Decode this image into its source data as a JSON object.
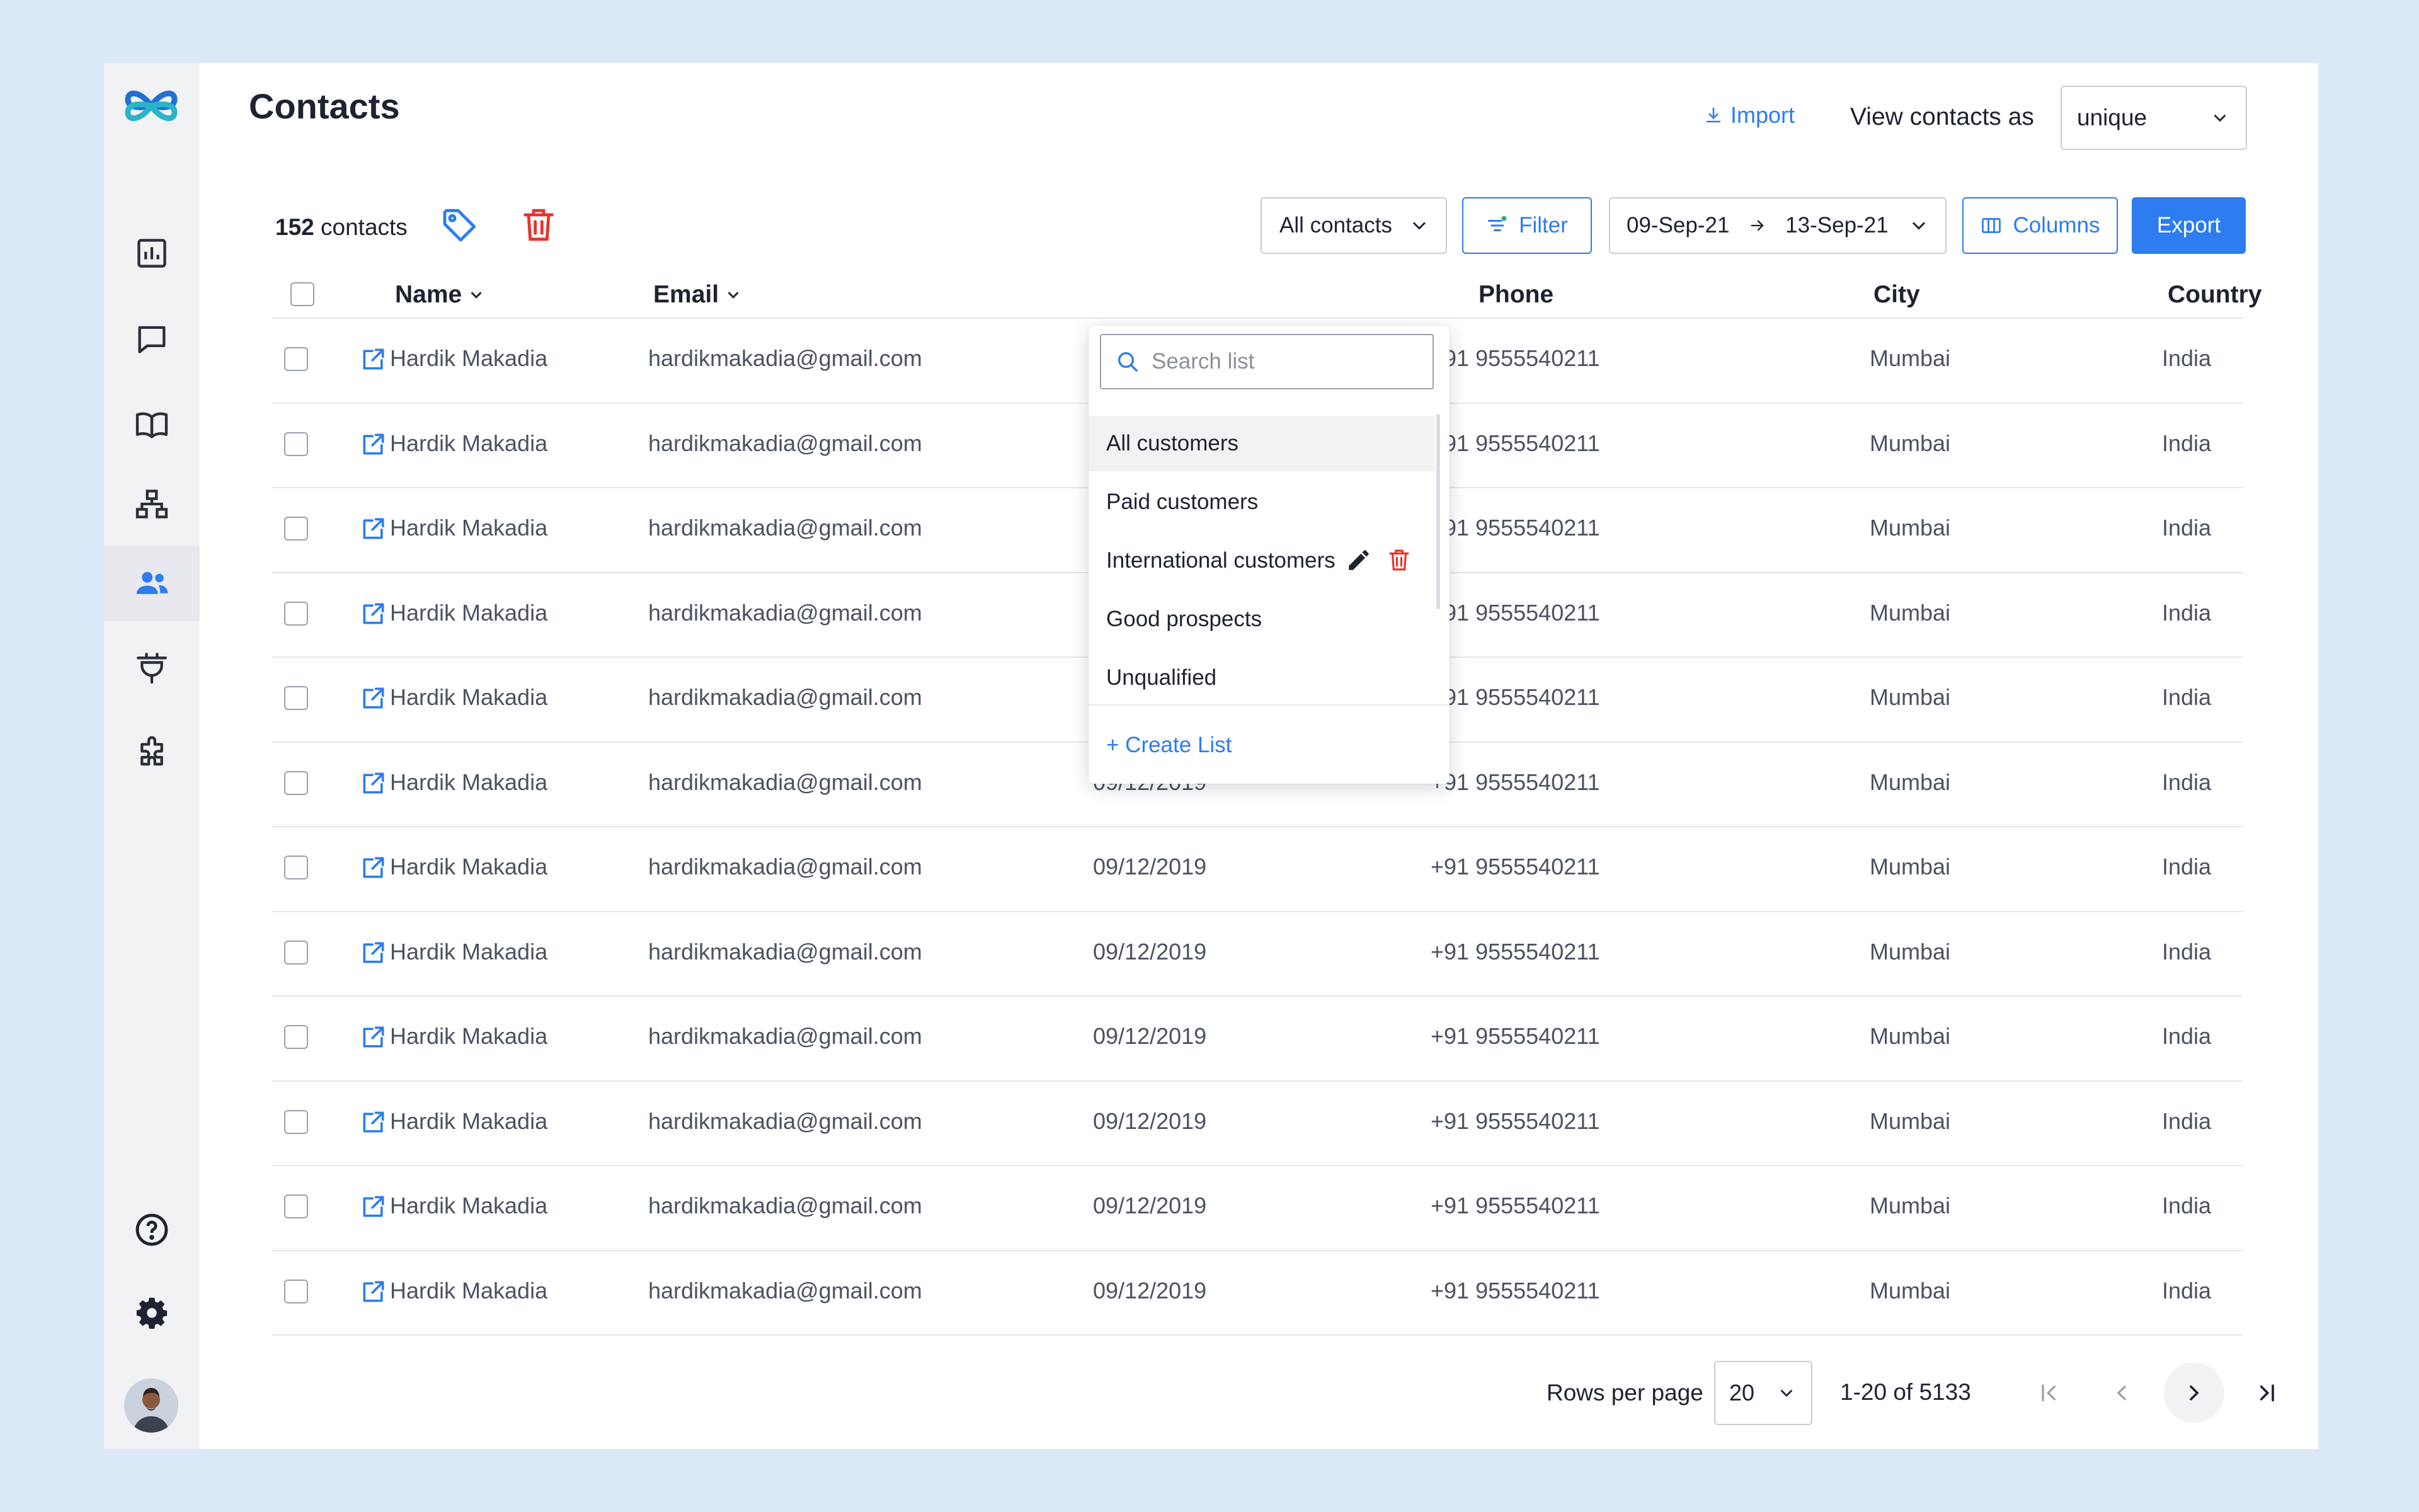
{
  "page": {
    "title": "Contacts"
  },
  "header": {
    "import_label": "Import",
    "view_as_label": "View contacts as",
    "view_as_value": "unique"
  },
  "toolbar": {
    "count_number": "152",
    "count_suffix": " contacts",
    "list_filter_value": "All contacts",
    "filter_label": "Filter",
    "date_from": "09-Sep-21",
    "date_to": "13-Sep-21",
    "columns_label": "Columns",
    "export_label": "Export"
  },
  "table": {
    "headers": {
      "name": "Name",
      "email": "Email",
      "phone": "Phone",
      "city": "City",
      "country": "Country"
    },
    "rows": [
      {
        "name": "Hardik Makadia",
        "email": "hardikmakadia@gmail.com",
        "date": "",
        "phone": "+91 9555540211",
        "city": "Mumbai",
        "country": "India"
      },
      {
        "name": "Hardik Makadia",
        "email": "hardikmakadia@gmail.com",
        "date": "",
        "phone": "+91 9555540211",
        "city": "Mumbai",
        "country": "India"
      },
      {
        "name": "Hardik Makadia",
        "email": "hardikmakadia@gmail.com",
        "date": "",
        "phone": "+91 9555540211",
        "city": "Mumbai",
        "country": "India"
      },
      {
        "name": "Hardik Makadia",
        "email": "hardikmakadia@gmail.com",
        "date": "",
        "phone": "+91 9555540211",
        "city": "Mumbai",
        "country": "India"
      },
      {
        "name": "Hardik Makadia",
        "email": "hardikmakadia@gmail.com",
        "date": "",
        "phone": "+91 9555540211",
        "city": "Mumbai",
        "country": "India"
      },
      {
        "name": "Hardik Makadia",
        "email": "hardikmakadia@gmail.com",
        "date": "09/12/2019",
        "phone": "+91 9555540211",
        "city": "Mumbai",
        "country": "India"
      },
      {
        "name": "Hardik Makadia",
        "email": "hardikmakadia@gmail.com",
        "date": "09/12/2019",
        "phone": "+91 9555540211",
        "city": "Mumbai",
        "country": "India"
      },
      {
        "name": "Hardik Makadia",
        "email": "hardikmakadia@gmail.com",
        "date": "09/12/2019",
        "phone": "+91 9555540211",
        "city": "Mumbai",
        "country": "India"
      },
      {
        "name": "Hardik Makadia",
        "email": "hardikmakadia@gmail.com",
        "date": "09/12/2019",
        "phone": "+91 9555540211",
        "city": "Mumbai",
        "country": "India"
      },
      {
        "name": "Hardik Makadia",
        "email": "hardikmakadia@gmail.com",
        "date": "09/12/2019",
        "phone": "+91 9555540211",
        "city": "Mumbai",
        "country": "India"
      },
      {
        "name": "Hardik Makadia",
        "email": "hardikmakadia@gmail.com",
        "date": "09/12/2019",
        "phone": "+91 9555540211",
        "city": "Mumbai",
        "country": "India"
      },
      {
        "name": "Hardik Makadia",
        "email": "hardikmakadia@gmail.com",
        "date": "09/12/2019",
        "phone": "+91 9555540211",
        "city": "Mumbai",
        "country": "India"
      }
    ]
  },
  "dropdown": {
    "search_placeholder": "Search list",
    "items": [
      {
        "label": "All customers"
      },
      {
        "label": "Paid customers"
      },
      {
        "label": "International customers"
      },
      {
        "label": "Good prospects"
      },
      {
        "label": "Unqualified"
      }
    ],
    "create_label": "+ Create List"
  },
  "pagination": {
    "rows_per_page_label": "Rows per page",
    "rows_per_page_value": "20",
    "range": "1-20 of 5133"
  },
  "sidebar": {
    "items": [
      {
        "icon": "bar-chart-icon"
      },
      {
        "icon": "chat-icon"
      },
      {
        "icon": "book-icon"
      },
      {
        "icon": "hierarchy-icon"
      },
      {
        "icon": "users-icon"
      },
      {
        "icon": "plug-icon"
      },
      {
        "icon": "puzzle-icon"
      }
    ],
    "bottom": [
      {
        "icon": "help-icon"
      },
      {
        "icon": "gear-icon"
      }
    ]
  },
  "colors": {
    "accent": "#2d7cf0",
    "danger": "#e8322b",
    "background": "#dbe8f8"
  }
}
